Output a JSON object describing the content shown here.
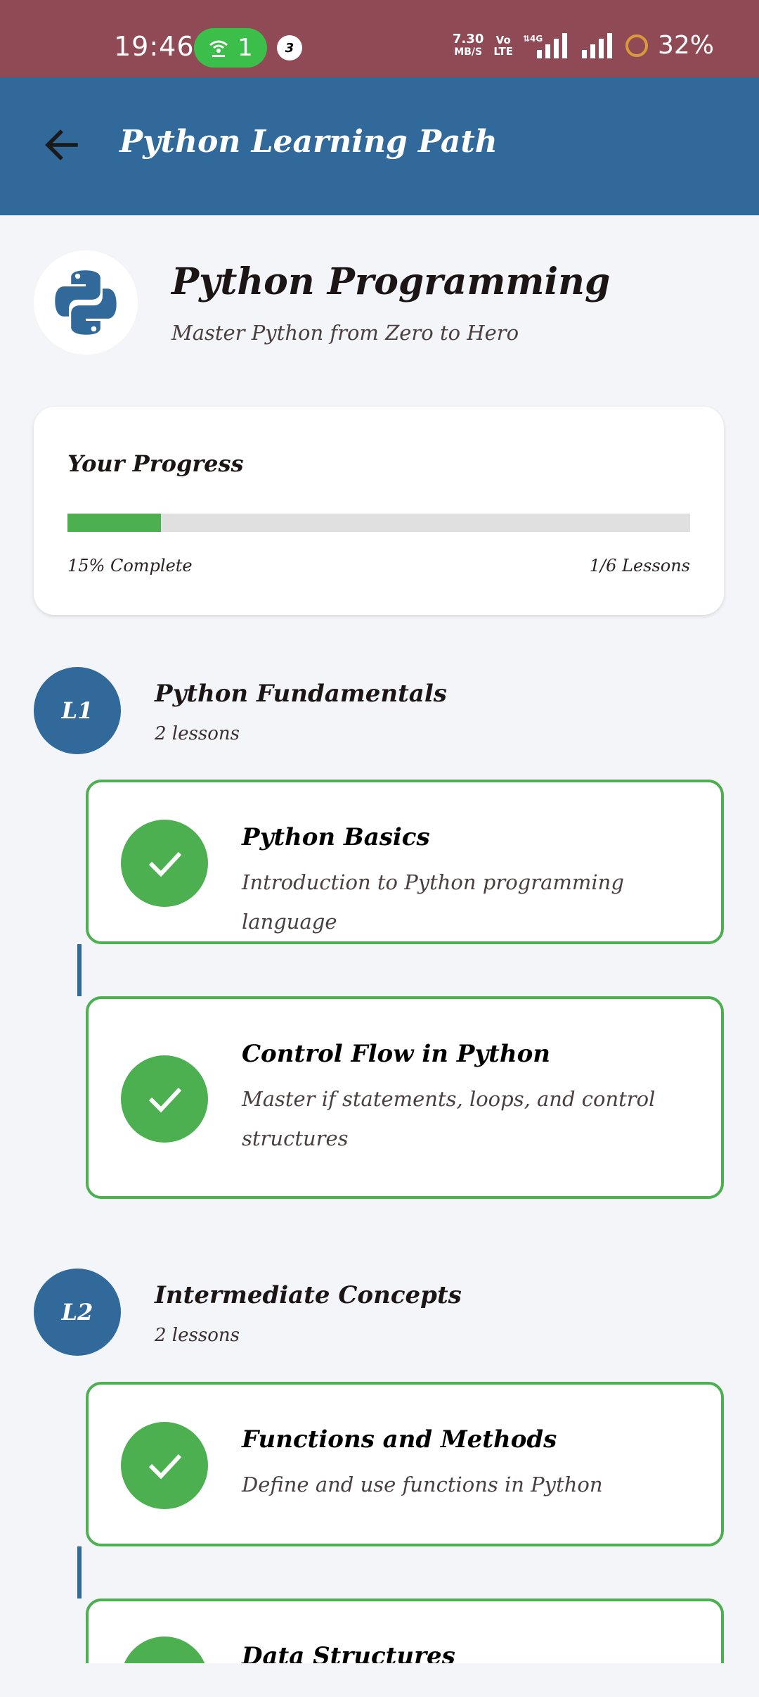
{
  "status_bar": {
    "time": "19:46",
    "hotspot_count": "1",
    "notification_count": "3",
    "net_speed_value": "7.30",
    "net_speed_unit": "MB/S",
    "volte_top": "Vo",
    "volte_bottom": "LTE",
    "battery": "32%"
  },
  "app_bar": {
    "title": "Python Learning Path"
  },
  "course": {
    "title": "Python Programming",
    "subtitle": "Master Python from Zero to Hero"
  },
  "progress": {
    "heading": "Your Progress",
    "percent": 15,
    "percent_label": "15% Complete",
    "lessons_label": "1/6 Lessons"
  },
  "levels": [
    {
      "badge": "L1",
      "title": "Python Fundamentals",
      "count": "2 lessons",
      "lessons": [
        {
          "title": "Python Basics",
          "description": "Introduction to Python programming language",
          "completed": true
        },
        {
          "title": "Control Flow in Python",
          "description": "Master if statements, loops, and control structures",
          "completed": true
        }
      ]
    },
    {
      "badge": "L2",
      "title": "Intermediate Concepts",
      "count": "2 lessons",
      "lessons": [
        {
          "title": "Functions and Methods",
          "description": "Define and use functions in Python",
          "completed": true
        },
        {
          "title": "Data Structures",
          "description": "",
          "completed": true
        }
      ]
    }
  ],
  "colors": {
    "status_bar": "#8f4a55",
    "primary": "#316a9a",
    "success": "#4caf50",
    "background": "#f4f5f9"
  }
}
